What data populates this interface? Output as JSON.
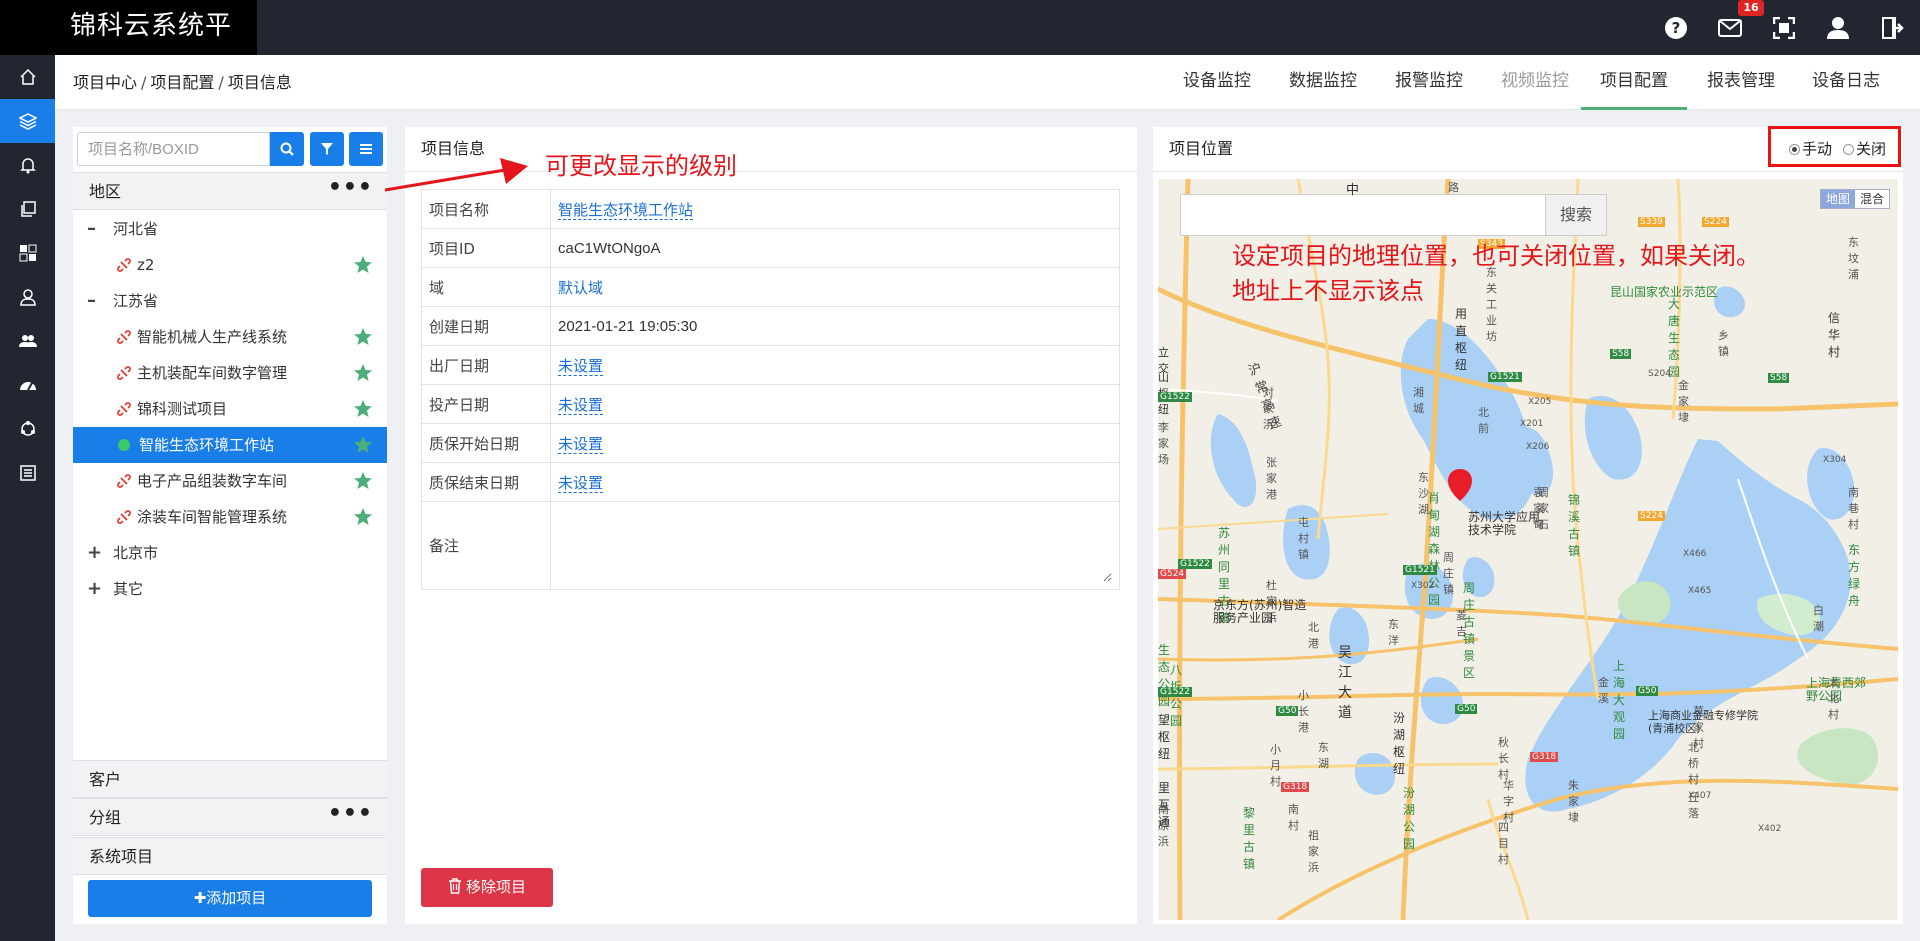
{
  "app": {
    "title": "锦科云系统平台",
    "notification_count": "16"
  },
  "topbar_icons": [
    "help-icon",
    "mail-icon",
    "fullscreen-icon",
    "user-icon",
    "logout-icon"
  ],
  "sidenav": [
    "home-icon",
    "layers-icon",
    "bell-icon",
    "copy-icon",
    "dashboard-icon",
    "person-icon",
    "group-icon",
    "gauge-icon",
    "cycle-icon",
    "list-icon"
  ],
  "breadcrumb": {
    "a": "项目中心",
    "b": "项目配置",
    "c": "项目信息",
    "sep": "/"
  },
  "tabs": [
    {
      "label": "设备监控"
    },
    {
      "label": "数据监控"
    },
    {
      "label": "报警监控"
    },
    {
      "label": "视频监控"
    },
    {
      "label": "项目配置"
    },
    {
      "label": "报表管理"
    },
    {
      "label": "设备日志"
    }
  ],
  "left": {
    "search_placeholder": "项目名称/BOXID",
    "region_header": "地区",
    "dots": "•••",
    "tree": {
      "hebei": {
        "toggle": "–",
        "label": "河北省"
      },
      "z2": {
        "label": "z2"
      },
      "jiangsu": {
        "toggle": "–",
        "label": "江苏省"
      },
      "p1": {
        "label": "智能机械人生产线系统"
      },
      "p2": {
        "label": "主机装配车间数字管理"
      },
      "p3": {
        "label": "锦科测试项目"
      },
      "p4": {
        "label": "智能生态环境工作站"
      },
      "p5": {
        "label": "电子产品组装数字车间"
      },
      "p6": {
        "label": "涂装车间智能管理系统"
      },
      "beijing": {
        "toggle": "+",
        "label": "北京市"
      },
      "other": {
        "toggle": "+",
        "label": "其它"
      }
    },
    "customer_header": "客户",
    "group_header": "分组",
    "system_header": "系统项目",
    "add_button": "✚添加项目"
  },
  "info": {
    "title": "项目信息",
    "rows": {
      "name": {
        "k": "项目名称",
        "v": "智能生态环境工作站"
      },
      "id": {
        "k": "项目ID",
        "v": "caC1WtONgoA"
      },
      "domain": {
        "k": "域",
        "v": "默认域"
      },
      "created": {
        "k": "创建日期",
        "v": "2021-01-21 19:05:30"
      },
      "factory": {
        "k": "出厂日期",
        "v": "未设置"
      },
      "production": {
        "k": "投产日期",
        "v": "未设置"
      },
      "warranty_start": {
        "k": "质保开始日期",
        "v": "未设置"
      },
      "warranty_end": {
        "k": "质保结束日期",
        "v": "未设置"
      },
      "remark": {
        "k": "备注",
        "v": ""
      }
    },
    "remove_button": "移除项目"
  },
  "annotations": {
    "level": "可更改显示的级别",
    "map_line1": "设定项目的地理位置，也可关闭位置，如果关闭。",
    "map_line2": "地址上不显示该点"
  },
  "map": {
    "title": "项目位置",
    "mode_manual": "手动",
    "mode_off": "关闭",
    "search_button": "搜索",
    "type_map": "地图",
    "type_hybrid": "混合",
    "labels": {
      "l1": "中",
      "l2": "路",
      "l3": "东关工业坊",
      "l4": "用直枢纽",
      "l5": "沪常高速",
      "l6": "对家浜",
      "l7": "湘城",
      "l8": "北前",
      "l9": "立交",
      "l10": "山枢纽",
      "l11": "李家场",
      "l12": "张家港",
      "l13": "东沙湖",
      "l14": "肖甸湖森林公园",
      "l15": "锦溪古镇",
      "l16": "苏州大学应用技术学院",
      "l17": "苏州同里古镇",
      "l18": "屯村镇",
      "l19": "周庄镇",
      "l20": "杜家浜",
      "l21": "周庄古镇景区",
      "l22": "京东方(苏州)智造服务产业园",
      "l23": "北港",
      "l24": "东洋",
      "l25": "吴江大道",
      "l26": "生态公园",
      "l27": "八坼公园",
      "l28": "小长港",
      "l29": "菱吉",
      "l30": "汾湖枢纽",
      "l31": "望枢纽",
      "l32": "小月村",
      "l33": "秋长村",
      "l34": "汾湖公园",
      "l35": "上海大观园",
      "l36": "上海青西郊野公园",
      "l37": "上海商业金融专修学院(青浦校区)",
      "l38": "北桥村",
      "l39": "黎里古镇",
      "l40": "昆山国家农业示范区",
      "l41": "大唐生态园",
      "l42": "信华村",
      "l43": "东坟浦",
      "l44": "乡镇",
      "l45": "金家埭",
      "l46": "南巷村",
      "l47": "东方绿舟",
      "l48": "白潮",
      "l49": "太北村",
      "l50": "莫家村",
      "l51": "金溪",
      "l52": "周家石",
      "l53": "里互通",
      "l54": "南原浜",
      "l55": "朱家埭",
      "l56": "华字村",
      "l57": "袁家甸",
      "l58": "丘落",
      "l59": "四目村",
      "l60": "南村",
      "l61": "祖家浜",
      "l62": "东湖"
    },
    "roads": {
      "g1521a": "G1521",
      "g1521b": "G1521",
      "g1522a": "G1522",
      "g1522b": "G1522",
      "g1522c": "G1522",
      "s224a": "S224",
      "s224b": "S224",
      "s58a": "S58",
      "s58b": "S58",
      "g50a": "G50",
      "g50b": "G50",
      "g50c": "G50",
      "g318a": "G318",
      "g318b": "G318",
      "x205": "X205",
      "x201": "X201",
      "x206": "X206",
      "x304": "X304",
      "x466": "X466",
      "x465": "X465",
      "x302": "X302",
      "x407": "X407",
      "x402": "X402",
      "s204": "S204",
      "g524": "G524",
      "s339": "S339",
      "s343": "S343"
    }
  }
}
